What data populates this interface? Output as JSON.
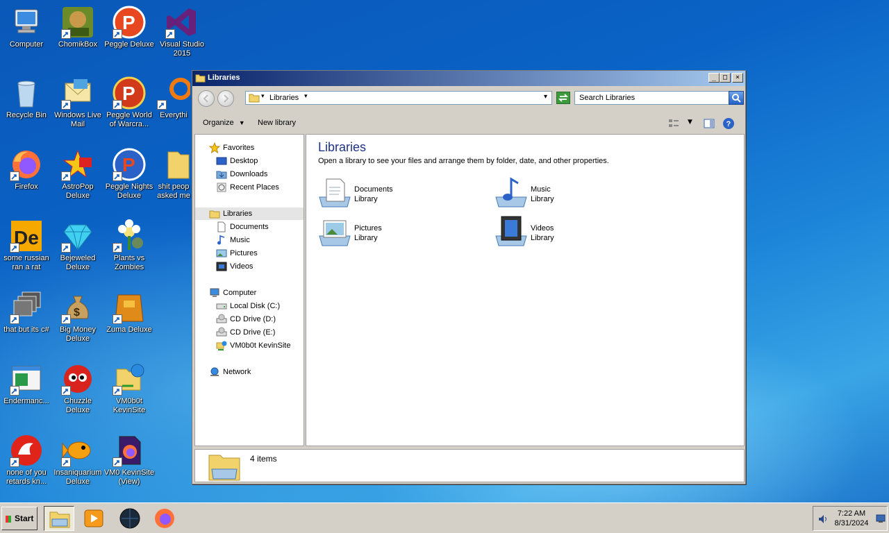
{
  "desktop": {
    "icons": [
      {
        "label": "Computer",
        "icon": "computer-icon"
      },
      {
        "label": "ChomikBox",
        "icon": "chomikbox-icon"
      },
      {
        "label": "Peggle Deluxe",
        "icon": "peggle-icon"
      },
      {
        "label": "Visual Studio 2015",
        "icon": "visual-studio-icon"
      },
      {
        "label": "Recycle Bin",
        "icon": "recycle-bin-icon"
      },
      {
        "label": "Windows Live Mail",
        "icon": "mail-icon"
      },
      {
        "label": "Peggle World of Warcra...",
        "icon": "peggle-icon"
      },
      {
        "label": "Everythi",
        "icon": "everything-icon"
      },
      {
        "label": "Firefox",
        "icon": "firefox-icon"
      },
      {
        "label": "AstroPop Deluxe",
        "icon": "astropop-icon"
      },
      {
        "label": "Peggle Nights Deluxe",
        "icon": "peggle-icon"
      },
      {
        "label": "shit peop asked me",
        "icon": "folder-icon"
      },
      {
        "label": "some russian ran a rat",
        "icon": "de-icon"
      },
      {
        "label": "Bejeweled Deluxe",
        "icon": "gem-icon"
      },
      {
        "label": "Plants vs Zombies",
        "icon": "flower-icon"
      },
      {
        "label": "that but its c#",
        "icon": "windows-stack-icon"
      },
      {
        "label": "Big Money Deluxe",
        "icon": "money-bag-icon"
      },
      {
        "label": "Zuma Deluxe",
        "icon": "zuma-icon"
      },
      {
        "label": "Endermanc...",
        "icon": "window-app-icon"
      },
      {
        "label": "Chuzzle Deluxe",
        "icon": "chuzzle-icon"
      },
      {
        "label": "VM0b0t KevinSite",
        "icon": "network-folder-icon"
      },
      {
        "label": "none of you retards kn...",
        "icon": "lobster-icon"
      },
      {
        "label": "Insaniquarium Deluxe",
        "icon": "fish-icon"
      },
      {
        "label": "VM0 KevinSite (View)",
        "icon": "firefox-doc-icon"
      }
    ]
  },
  "window": {
    "title": "Libraries",
    "controls": {
      "minimize": "_",
      "maximize": "□",
      "close": "×"
    },
    "address": {
      "path": "Libraries",
      "dropdown": "▾"
    },
    "search": {
      "placeholder": "Search Libraries"
    },
    "toolbar": {
      "organize": "Organize",
      "new_library": "New library"
    },
    "nav": {
      "favorites": {
        "label": "Favorites",
        "items": [
          "Desktop",
          "Downloads",
          "Recent Places"
        ]
      },
      "libraries": {
        "label": "Libraries",
        "items": [
          "Documents",
          "Music",
          "Pictures",
          "Videos"
        ]
      },
      "computer": {
        "label": "Computer",
        "items": [
          "Local Disk (C:)",
          "CD Drive (D:)",
          "CD Drive (E:)",
          "VM0b0t KevinSite"
        ]
      },
      "network": {
        "label": "Network"
      }
    },
    "content": {
      "heading": "Libraries",
      "description": "Open a library to see your files and arrange them by folder, date, and other properties.",
      "libraries": [
        {
          "name": "Documents",
          "type": "Library"
        },
        {
          "name": "Music",
          "type": "Library"
        },
        {
          "name": "Pictures",
          "type": "Library"
        },
        {
          "name": "Videos",
          "type": "Library"
        }
      ]
    },
    "details": {
      "count": "4 items"
    }
  },
  "taskbar": {
    "start_label": "Start",
    "clock": {
      "time": "7:22 AM",
      "date": "8/31/2024"
    }
  }
}
